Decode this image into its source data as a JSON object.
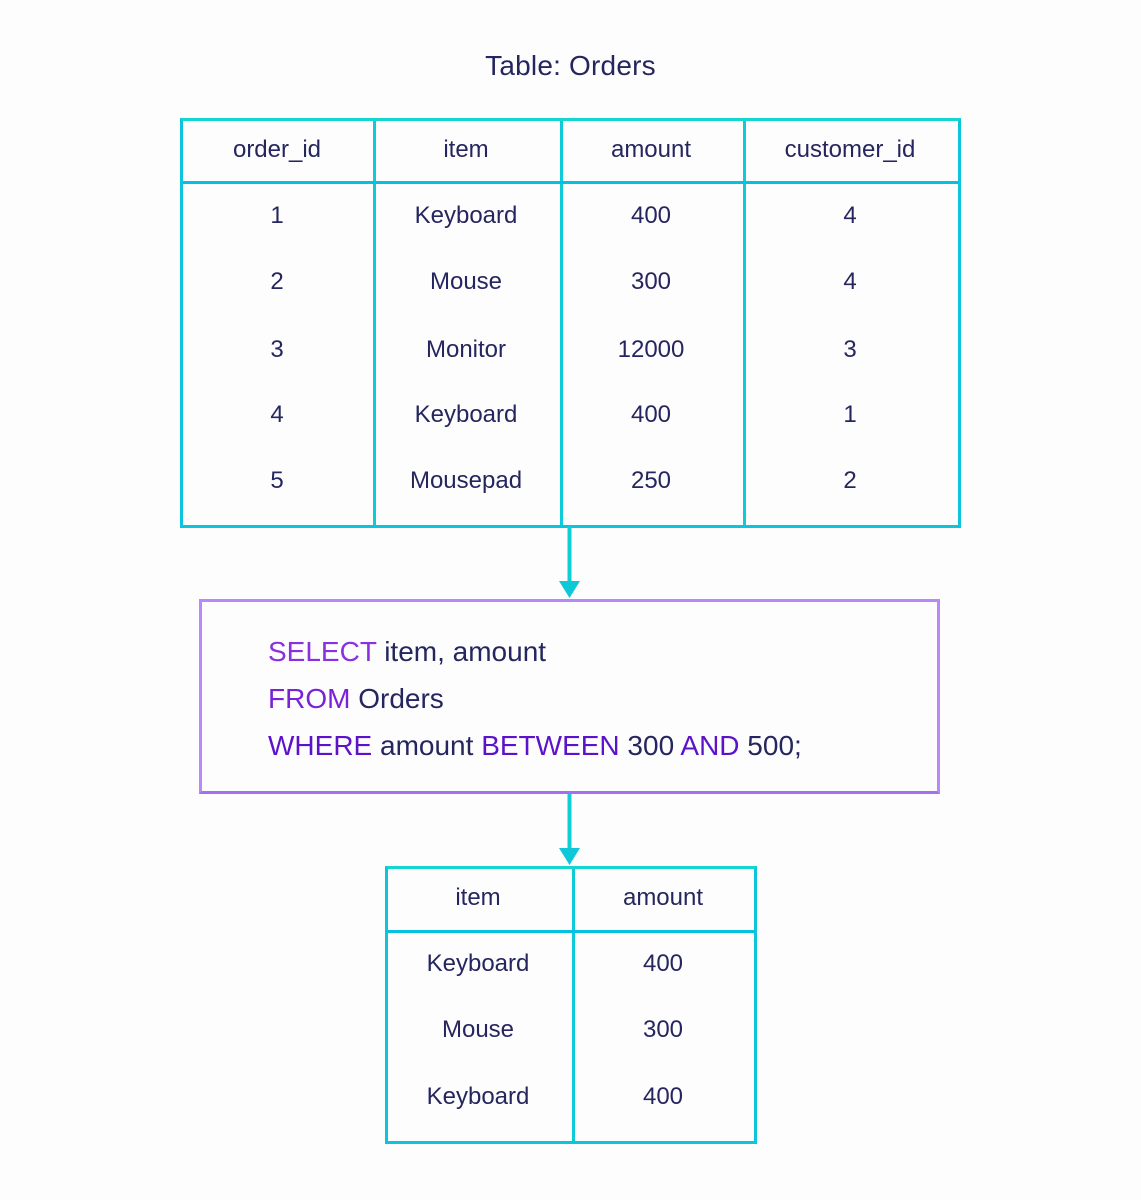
{
  "title": "Table: Orders",
  "colors": {
    "text": "#25265e",
    "table_border": "#0cc5dd",
    "arrow": "#0fcfd4",
    "sql_border": "#b98af5",
    "keyword": "#7a22d8"
  },
  "orders_table": {
    "columns": [
      "order_id",
      "item",
      "amount",
      "customer_id"
    ],
    "rows": [
      [
        "1",
        "Keyboard",
        "400",
        "4"
      ],
      [
        "2",
        "Mouse",
        "300",
        "4"
      ],
      [
        "3",
        "Monitor",
        "12000",
        "3"
      ],
      [
        "4",
        "Keyboard",
        "400",
        "1"
      ],
      [
        "5",
        "Mousepad",
        "250",
        "2"
      ]
    ]
  },
  "query": {
    "lines": [
      [
        {
          "t": "SELECT",
          "kw": true
        },
        {
          "t": " item, amount",
          "kw": false
        }
      ],
      [
        {
          "t": "FROM",
          "kw": true
        },
        {
          "t": " Orders",
          "kw": false
        }
      ],
      [
        {
          "t": "WHERE",
          "kw": true
        },
        {
          "t": " amount ",
          "kw": false
        },
        {
          "t": "BETWEEN",
          "kw": true
        },
        {
          "t": " 300 ",
          "kw": false
        },
        {
          "t": "AND",
          "kw": true
        },
        {
          "t": " 500;",
          "kw": false
        }
      ]
    ]
  },
  "result_table": {
    "columns": [
      "item",
      "amount"
    ],
    "rows": [
      [
        "Keyboard",
        "400"
      ],
      [
        "Mouse",
        "300"
      ],
      [
        "Keyboard",
        "400"
      ]
    ]
  }
}
